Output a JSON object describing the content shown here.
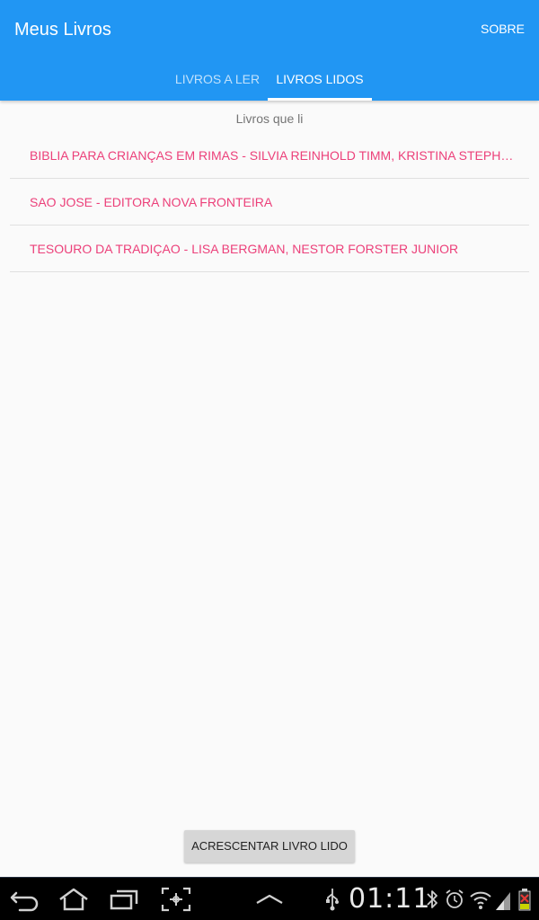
{
  "app": {
    "title": "Meus Livros",
    "about_label": "SOBRE",
    "primary_color": "#2196f3",
    "accent_color": "#ec407a"
  },
  "tabs": [
    {
      "label": "LIVROS A LER",
      "selected": false
    },
    {
      "label": "LIVROS LIDOS",
      "selected": true
    }
  ],
  "content": {
    "section_header": "Livros que li",
    "books": [
      {
        "text": "BIBLIA PARA CRIANÇAS EM RIMAS - SILVIA REINHOLD TIMM, KRISTINA STEPHENSON"
      },
      {
        "text": "SAO JOSE - EDITORA NOVA FRONTEIRA"
      },
      {
        "text": "TESOURO DA TRADIÇAO - LISA BERGMAN, NESTOR FORSTER JUNIOR"
      }
    ],
    "add_button_label": "ACRESCENTAR LIVRO LIDO"
  },
  "system_bar": {
    "clock": "01:11",
    "icons": [
      "back-icon",
      "home-icon",
      "recent-apps-icon",
      "screenshot-icon",
      "menu-up-icon",
      "usb-icon",
      "bluetooth-icon",
      "alarm-icon",
      "wifi-icon",
      "signal-icon",
      "battery-icon"
    ]
  }
}
